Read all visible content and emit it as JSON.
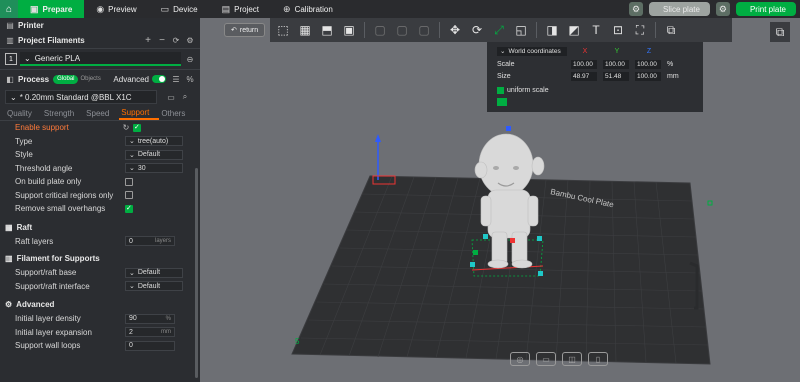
{
  "topbar": {
    "tabs": [
      {
        "label": "Prepare",
        "icon": "cube-icon",
        "active": true
      },
      {
        "label": "Preview",
        "icon": "eye-icon",
        "active": false
      },
      {
        "label": "Device",
        "icon": "device-icon",
        "active": false
      },
      {
        "label": "Project",
        "icon": "folder-icon",
        "active": false
      },
      {
        "label": "Calibration",
        "icon": "calibration-icon",
        "active": false
      }
    ],
    "slice_label": "Slice plate",
    "print_label": "Print plate"
  },
  "sidebar": {
    "printer_label": "Printer",
    "filaments_label": "Project Filaments",
    "filament_index": "1",
    "filament_name": "Generic PLA",
    "process_label": "Process",
    "global_label": "Global",
    "objects_label": "Objects",
    "advanced_label": "Advanced",
    "preset_name": "* 0.20mm Standard @BBL X1C",
    "tabs": [
      "Quality",
      "Strength",
      "Speed",
      "Support",
      "Others"
    ],
    "active_tab": "Support",
    "support": {
      "enable_label": "Enable support",
      "type_label": "Type",
      "type_value": "tree(auto)",
      "style_label": "Style",
      "style_value": "Default",
      "threshold_label": "Threshold angle",
      "threshold_value": "30",
      "on_build_plate_label": "On build plate only",
      "critical_label": "Support critical regions only",
      "remove_small_label": "Remove small overhangs"
    },
    "raft": {
      "header": "Raft",
      "layers_label": "Raft layers",
      "layers_value": "0",
      "layers_unit": "layers"
    },
    "filament_supports": {
      "header": "Filament for Supports",
      "base_label": "Support/raft base",
      "base_value": "Default",
      "interface_label": "Support/raft interface",
      "interface_value": "Default"
    },
    "advanced": {
      "header": "Advanced",
      "density_label": "Initial layer density",
      "density_value": "90",
      "density_unit": "%",
      "expansion_label": "Initial layer expansion",
      "expansion_value": "2",
      "expansion_unit": "mm",
      "wall_loops_label": "Support wall loops",
      "wall_loops_value": "0"
    }
  },
  "viewport": {
    "return_label": "return",
    "coords": {
      "mode": "World coordinates",
      "x": "X",
      "y": "Y",
      "z": "Z",
      "scale_label": "Scale",
      "scale_x": "100.00",
      "scale_y": "100.00",
      "scale_z": "100.00",
      "scale_unit": "%",
      "size_label": "Size",
      "size_x": "48.97",
      "size_y": "51.48",
      "size_z": "100.00",
      "size_unit": "mm",
      "uniform_label": "uniform scale"
    },
    "plate_text": "Bambu Cool Plate",
    "plate_number": "5"
  },
  "colors": {
    "accent": "#00ae42",
    "tab_active": "#ff6f00",
    "panel": "#2b2d31"
  }
}
